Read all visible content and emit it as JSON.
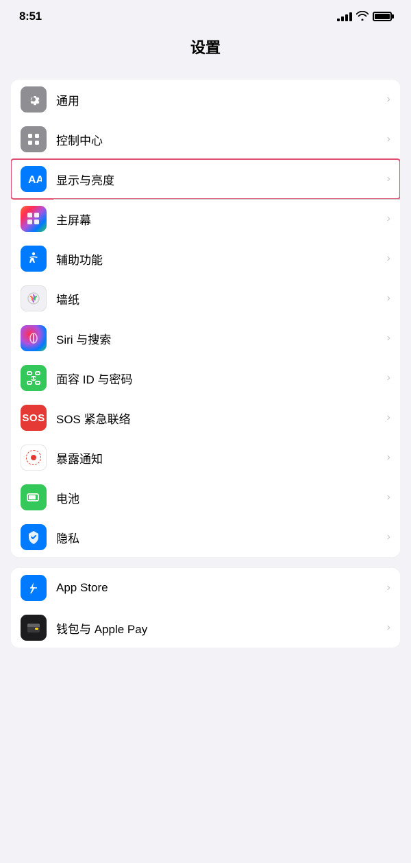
{
  "statusBar": {
    "time": "8:51",
    "signalLabel": "signal",
    "wifiLabel": "wifi",
    "batteryLabel": "battery"
  },
  "pageTitle": "设置",
  "group1": {
    "items": [
      {
        "id": "general",
        "label": "通用",
        "iconBg": "gray",
        "iconType": "gear"
      },
      {
        "id": "control-center",
        "label": "控制中心",
        "iconBg": "gray",
        "iconType": "control"
      },
      {
        "id": "display",
        "label": "显示与亮度",
        "iconBg": "blue",
        "iconType": "display",
        "highlighted": true
      },
      {
        "id": "home-screen",
        "label": "主屏幕",
        "iconBg": "colorful",
        "iconType": "home"
      },
      {
        "id": "accessibility",
        "label": "辅助功能",
        "iconBg": "blue",
        "iconType": "access"
      },
      {
        "id": "wallpaper",
        "label": "墙纸",
        "iconBg": "flower",
        "iconType": "wallpaper"
      },
      {
        "id": "siri",
        "label": "Siri 与搜索",
        "iconBg": "siri",
        "iconType": "siri"
      },
      {
        "id": "faceid",
        "label": "面容 ID 与密码",
        "iconBg": "green",
        "iconType": "faceid"
      },
      {
        "id": "sos",
        "label": "SOS 紧急联络",
        "iconBg": "red",
        "iconType": "sos"
      },
      {
        "id": "exposure",
        "label": "暴露通知",
        "iconBg": "white",
        "iconType": "exposure"
      },
      {
        "id": "battery",
        "label": "电池",
        "iconBg": "green",
        "iconType": "battery"
      },
      {
        "id": "privacy",
        "label": "隐私",
        "iconBg": "blue3",
        "iconType": "privacy"
      }
    ]
  },
  "group2": {
    "items": [
      {
        "id": "appstore",
        "label": "App Store",
        "iconBg": "blue",
        "iconType": "appstore"
      },
      {
        "id": "wallet",
        "label": "钱包与 Apple Pay",
        "iconBg": "black",
        "iconType": "wallet"
      }
    ]
  },
  "chevron": "›"
}
